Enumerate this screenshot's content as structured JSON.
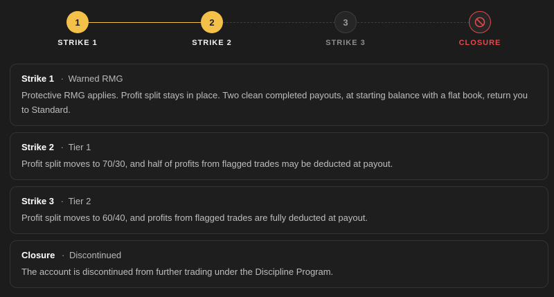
{
  "stepper": {
    "steps": [
      {
        "number": "1",
        "label": "STRIKE 1",
        "status": "done"
      },
      {
        "number": "2",
        "label": "STRIKE 2",
        "status": "done"
      },
      {
        "number": "3",
        "label": "STRIKE 3",
        "status": "pending"
      },
      {
        "icon": "ban-icon",
        "label": "CLOSURE",
        "status": "closed"
      }
    ]
  },
  "cards": [
    {
      "title": "Strike 1",
      "separator": "·",
      "subtitle": "Warned RMG",
      "body": "Protective RMG applies. Profit split stays in place. Two clean completed payouts, at starting balance with a flat book, return you to Standard."
    },
    {
      "title": "Strike 2",
      "separator": "·",
      "subtitle": "Tier 1",
      "body": "Profit split moves to 70/30, and half of profits from flagged trades may be deducted at payout."
    },
    {
      "title": "Strike 3",
      "separator": "·",
      "subtitle": "Tier 2",
      "body": "Profit split moves to 60/40, and profits from flagged trades are fully deducted at payout."
    },
    {
      "title": "Closure",
      "separator": "·",
      "subtitle": "Discontinued",
      "body": "The account is discontinued from further trading under the Discipline Program."
    }
  ],
  "colors": {
    "accent": "#f3c04a",
    "danger": "#e5484d",
    "background": "#1c1c1c"
  }
}
